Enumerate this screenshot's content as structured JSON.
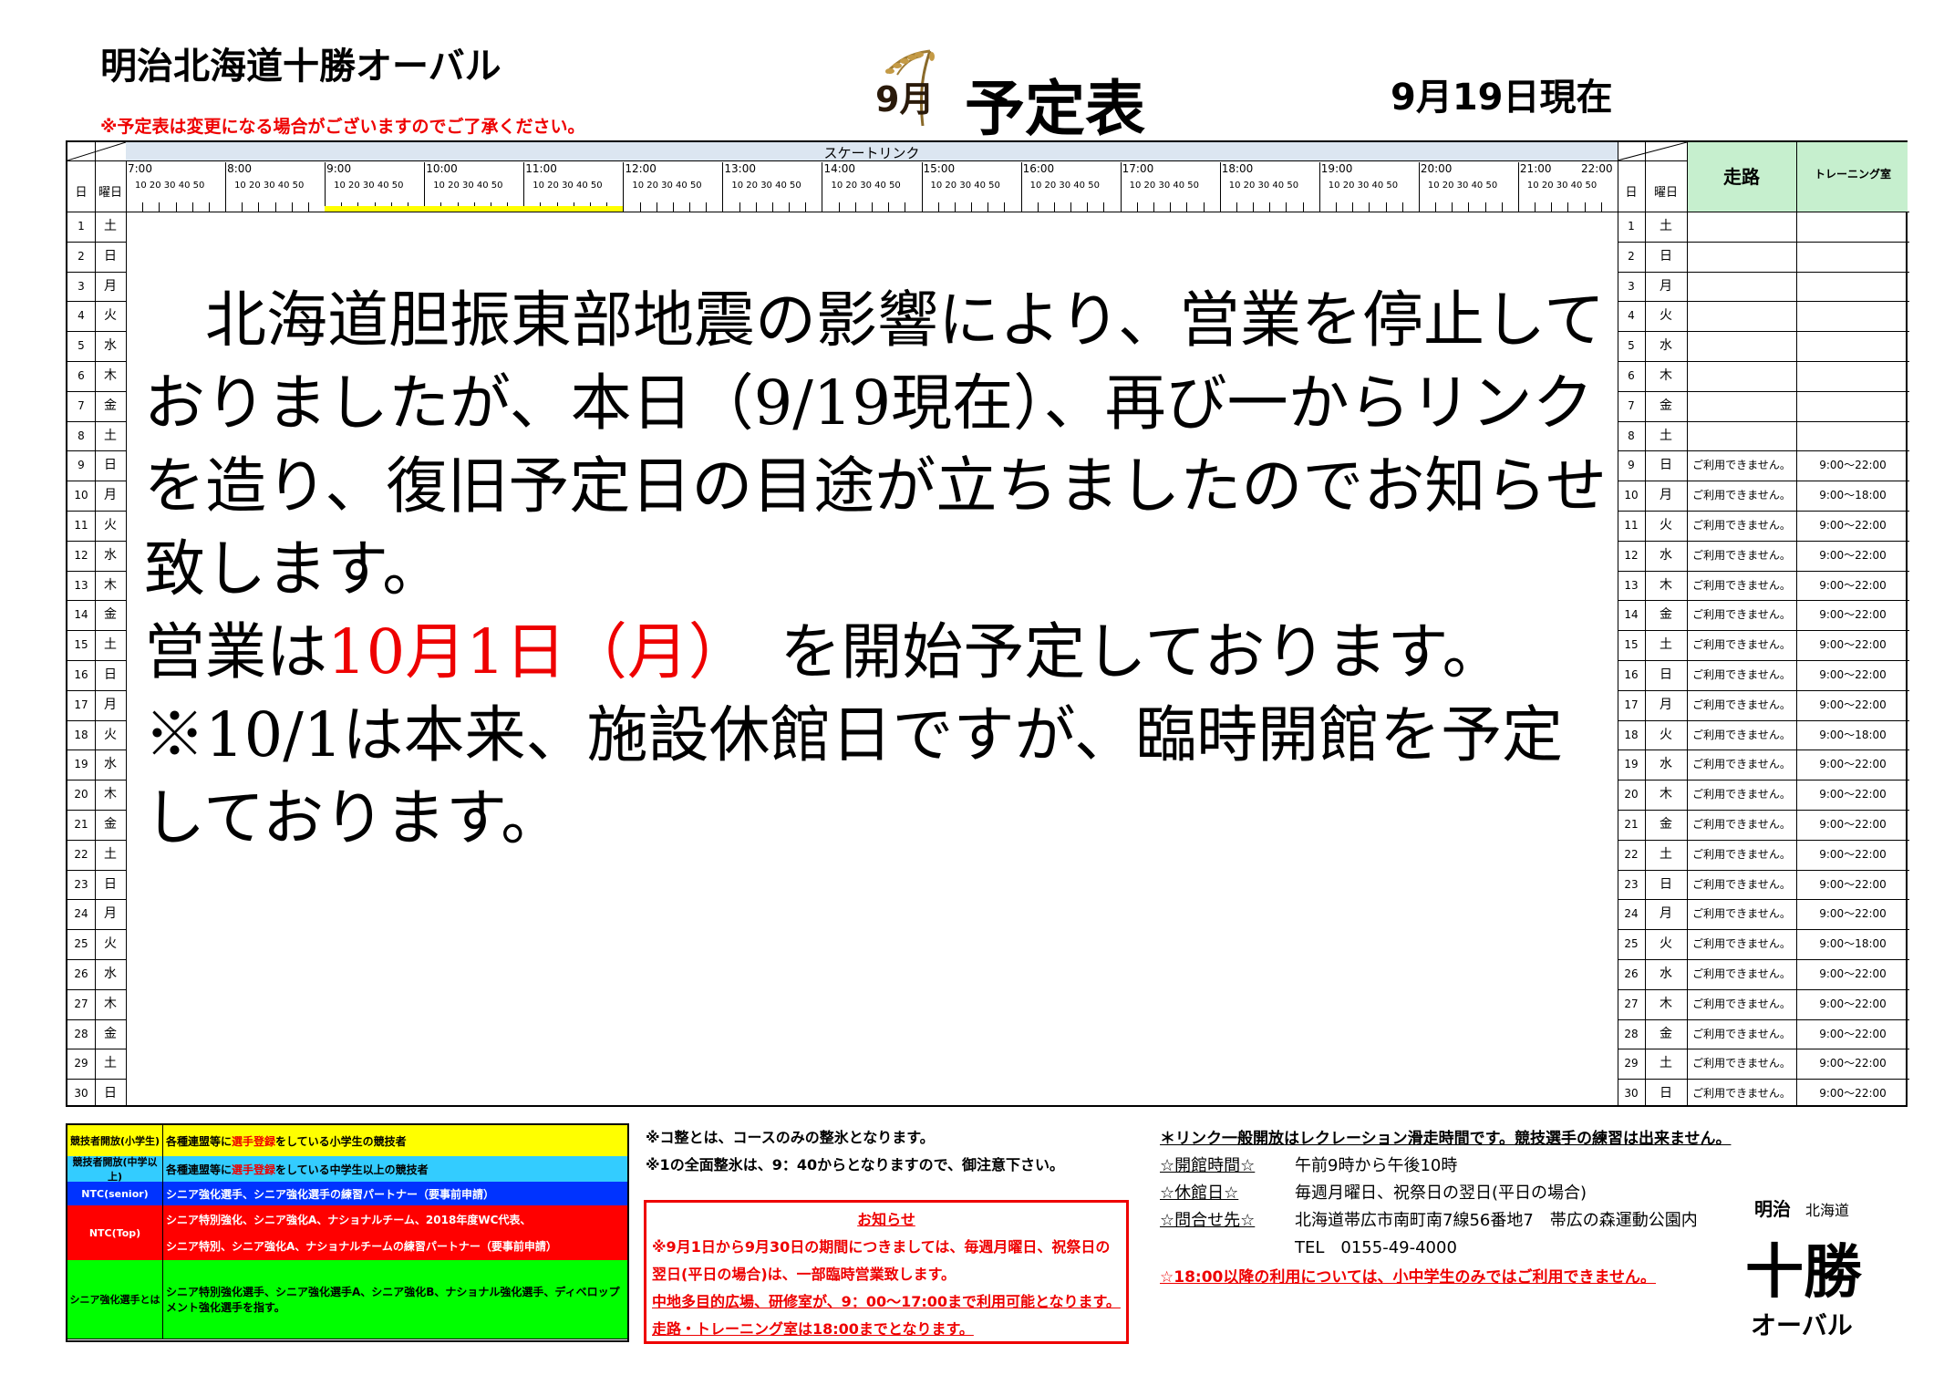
{
  "header": {
    "venue": "明治北海道十勝オーバル",
    "month_badge": "9月",
    "title": "予定表",
    "as_of": "9月19日現在",
    "note": "※予定表は変更になる場合がございますのでご了承ください。"
  },
  "grid": {
    "rink_label": "スケートリンク",
    "day_col": "日",
    "weekday_col": "曜日",
    "track_label": "走路",
    "training_label": "トレーニング室",
    "hours": [
      "7:00",
      "8:00",
      "9:00",
      "10:00",
      "11:00",
      "12:00",
      "13:00",
      "14:00",
      "15:00",
      "16:00",
      "17:00",
      "18:00",
      "19:00",
      "20:00",
      "21:00",
      "22:00"
    ],
    "minute_ticks": "10 20 30 40 50",
    "days": [
      {
        "d": "1",
        "w": "土",
        "track": "",
        "training": ""
      },
      {
        "d": "2",
        "w": "日",
        "track": "",
        "training": ""
      },
      {
        "d": "3",
        "w": "月",
        "track": "",
        "training": ""
      },
      {
        "d": "4",
        "w": "火",
        "track": "",
        "training": ""
      },
      {
        "d": "5",
        "w": "水",
        "track": "",
        "training": ""
      },
      {
        "d": "6",
        "w": "木",
        "track": "",
        "training": ""
      },
      {
        "d": "7",
        "w": "金",
        "track": "",
        "training": ""
      },
      {
        "d": "8",
        "w": "土",
        "track": "",
        "training": ""
      },
      {
        "d": "9",
        "w": "日",
        "track": "ご利用できません。",
        "training": "9:00～22:00"
      },
      {
        "d": "10",
        "w": "月",
        "track": "ご利用できません。",
        "training": "9:00～18:00"
      },
      {
        "d": "11",
        "w": "火",
        "track": "ご利用できません。",
        "training": "9:00～22:00"
      },
      {
        "d": "12",
        "w": "水",
        "track": "ご利用できません。",
        "training": "9:00～22:00"
      },
      {
        "d": "13",
        "w": "木",
        "track": "ご利用できません。",
        "training": "9:00～22:00"
      },
      {
        "d": "14",
        "w": "金",
        "track": "ご利用できません。",
        "training": "9:00～22:00"
      },
      {
        "d": "15",
        "w": "土",
        "track": "ご利用できません。",
        "training": "9:00～22:00"
      },
      {
        "d": "16",
        "w": "日",
        "track": "ご利用できません。",
        "training": "9:00～22:00"
      },
      {
        "d": "17",
        "w": "月",
        "track": "ご利用できません。",
        "training": "9:00～22:00"
      },
      {
        "d": "18",
        "w": "火",
        "track": "ご利用できません。",
        "training": "9:00～18:00"
      },
      {
        "d": "19",
        "w": "水",
        "track": "ご利用できません。",
        "training": "9:00～22:00"
      },
      {
        "d": "20",
        "w": "木",
        "track": "ご利用できません。",
        "training": "9:00～22:00"
      },
      {
        "d": "21",
        "w": "金",
        "track": "ご利用できません。",
        "training": "9:00～22:00"
      },
      {
        "d": "22",
        "w": "土",
        "track": "ご利用できません。",
        "training": "9:00～22:00"
      },
      {
        "d": "23",
        "w": "日",
        "track": "ご利用できません。",
        "training": "9:00～22:00"
      },
      {
        "d": "24",
        "w": "月",
        "track": "ご利用できません。",
        "training": "9:00～22:00"
      },
      {
        "d": "25",
        "w": "火",
        "track": "ご利用できません。",
        "training": "9:00～18:00"
      },
      {
        "d": "26",
        "w": "水",
        "track": "ご利用できません。",
        "training": "9:00～22:00"
      },
      {
        "d": "27",
        "w": "木",
        "track": "ご利用できません。",
        "training": "9:00～22:00"
      },
      {
        "d": "28",
        "w": "金",
        "track": "ご利用できません。",
        "training": "9:00～22:00"
      },
      {
        "d": "29",
        "w": "土",
        "track": "ご利用できません。",
        "training": "9:00～22:00"
      },
      {
        "d": "30",
        "w": "日",
        "track": "ご利用できません。",
        "training": "9:00～22:00"
      }
    ]
  },
  "notice": {
    "p1": "　北海道胆振東部地震の影響により、営業を停止しておりましたが、本日（9/19現在）、再び一からリンクを造り、復旧予定日の目途が立ちましたのでお知らせ致します。",
    "p2_before": "営業は",
    "p2_date": "10月1日（月）",
    "p2_after": "　を開始予定しております。",
    "p3": "※10/1は本来、施設休館日ですが、臨時開館を予定しております。"
  },
  "legend": [
    {
      "key": "競技者開放(小学生)",
      "value_pre": "各種連盟等に",
      "value_red": "選手登録",
      "value_post": "をしている小学生の競技者",
      "color": "#ffff00"
    },
    {
      "key": "競技者開放(中学以上)",
      "value_pre": "各種連盟等に",
      "value_red": "選手登録",
      "value_post": "をしている中学生以上の競技者",
      "color": "#33ccff"
    },
    {
      "key": "NTC(senior)",
      "value_pre": "シニア強化選手、シニア強化選手の練習パートナー（要事前申請）",
      "value_red": "",
      "value_post": "",
      "color": "#0033ff"
    },
    {
      "key": "NTC(Top)",
      "value_pre": "シニア特別強化、シニア強化A、ナショナルチーム、2018年度WC代表、",
      "value_red": "",
      "value_post": "シニア特別、シニア強化A、ナショナルチームの練習パートナー（要事前申請）",
      "color": "#ff0000"
    },
    {
      "key": "シニア強化選手とは",
      "value_pre": "シニア特別強化選手、シニア強化選手A、シニア強化B、ナショナル強化選手、ディベロップメント強化選手を指す。",
      "value_red": "",
      "value_post": "",
      "color": "#00ff00"
    }
  ],
  "middle_notes": {
    "n1": "※コ整とは、コースのみの整氷となります。",
    "n2": "※1の全面整氷は、9：40からとなりますので、御注意下さい。",
    "oshirase_title": "お知らせ",
    "o1": "※9月1日から9月30日の期間につきましては、毎週月曜日、祝祭日の翌日(平日の場合)は、一部臨時営業致します。",
    "o2": "中地多目的広場、研修室が、9：00～17:00まで利用可能となります。走路・トレーニング室は18:00までとなります。"
  },
  "right_info": {
    "rink_note": "＊リンク一般開放はレクレーション滑走時間です。競技選手の練習は出来ません。",
    "hours_label": "☆開館時間☆",
    "hours_value": "午前9時から午後10時",
    "closed_label": "☆休館日☆",
    "closed_value": "毎週月曜日、祝祭日の翌日(平日の場合)",
    "contact_label": "☆問合せ先☆",
    "contact_value": "北海道帯広市南町南7線56番地7　帯広の森運動公園内",
    "tel": "TEL　0155-49-4000",
    "after18": "☆18:00以降の利用については、小中学生のみではご利用できません。"
  },
  "brand": {
    "line1": "明治",
    "line2": "北海道",
    "line3": "十勝",
    "line4": "オーバル"
  }
}
